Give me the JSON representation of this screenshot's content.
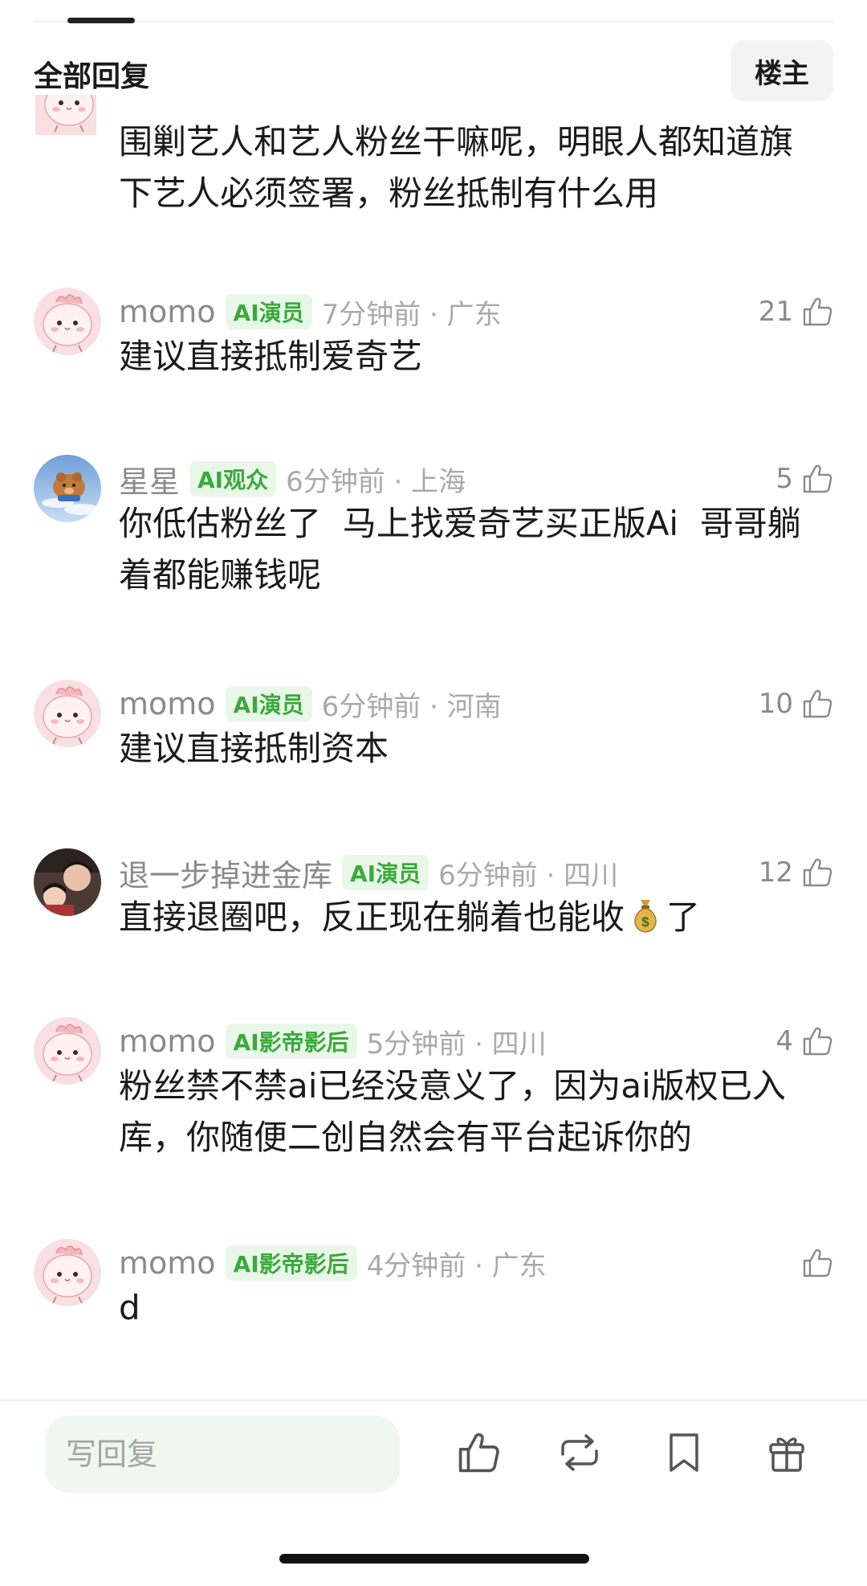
{
  "header": {
    "title": "全部回复",
    "op_button_label": "楼主"
  },
  "partial_comment": {
    "content": "围剿艺人和艺人粉丝干嘛呢，明眼人都知道旗下艺人必须签署，粉丝抵制有什么用"
  },
  "comments": [
    {
      "username": "momo",
      "badge": "AI演员",
      "time": "7分钟前 · 广东",
      "likes": "21",
      "content": "建议直接抵制爱奇艺",
      "avatar": "pink-bird-avatar"
    },
    {
      "username": "星星",
      "badge": "AI观众",
      "time": "6分钟前 · 上海",
      "likes": "5",
      "content": "你低估粉丝了  马上找爱奇艺买正版Ai  哥哥躺着都能赚钱呢",
      "avatar": "bear-avatar"
    },
    {
      "username": "momo",
      "badge": "AI演员",
      "time": "6分钟前 · 河南",
      "likes": "10",
      "content": "建议直接抵制资本",
      "avatar": "pink-bird-avatar"
    },
    {
      "username": "退一步掉进金库",
      "badge": "AI演员",
      "time": "6分钟前 · 四川",
      "likes": "12",
      "content_before": "直接退圈吧，反正现在躺着也能收",
      "emoji": "money-bag-emoji",
      "content_after": "了",
      "avatar": "photo-avatar"
    },
    {
      "username": "momo",
      "badge": "AI影帝影后",
      "time": "5分钟前 · 四川",
      "likes": "4",
      "content": "粉丝禁不禁ai已经没意义了，因为ai版权已入库，你随便二创自然会有平台起诉你的",
      "avatar": "pink-bird-avatar"
    },
    {
      "username": "momo",
      "badge": "AI影帝影后",
      "time": "4分钟前 · 广东",
      "likes": "",
      "content": "d",
      "avatar": "pink-bird-avatar"
    }
  ],
  "bottom_bar": {
    "reply_placeholder": "写回复",
    "actions": [
      "thumbs-up-icon",
      "repost-icon",
      "bookmark-icon",
      "gift-icon"
    ]
  },
  "colors": {
    "badge_bg": "#e9f7e9",
    "badge_text": "#3aaa3a",
    "meta_text": "#8a8a8a",
    "reply_bg": "#f0f6f0"
  }
}
